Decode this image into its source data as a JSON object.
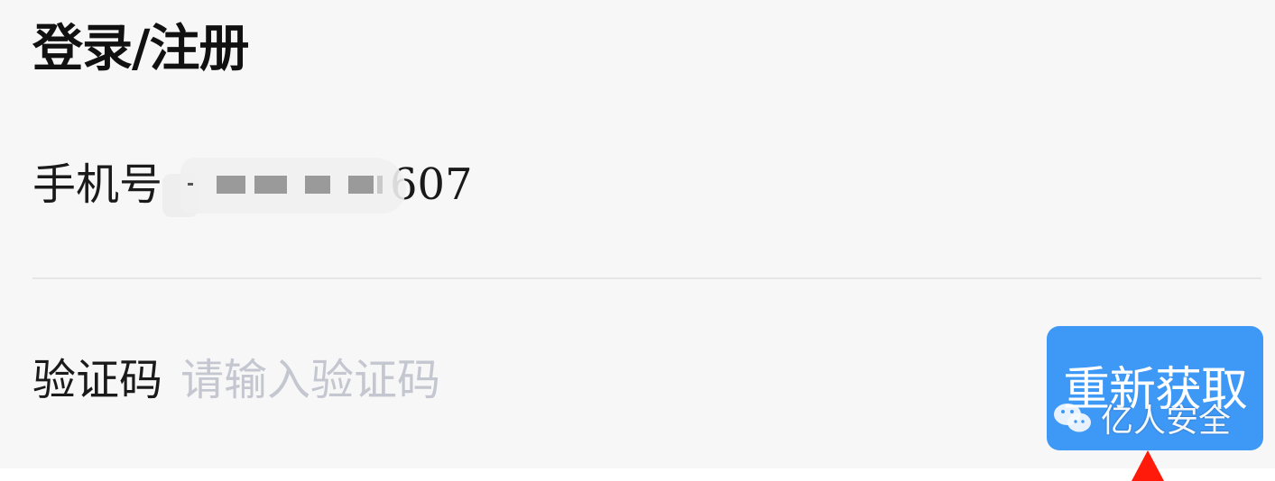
{
  "header": {
    "title": "登录/注册"
  },
  "form": {
    "phone": {
      "label": "手机号",
      "value_suffix": "607"
    },
    "code": {
      "label": "验证码",
      "placeholder": "请输入验证码"
    },
    "resend_button": "重新获取"
  },
  "watermark": {
    "text": "亿人安全",
    "icon": "wechat-icon"
  },
  "colors": {
    "button_bg": "#3e98f6",
    "panel_bg": "#f7f7f7",
    "placeholder": "#c4c7d0",
    "arrow": "#ff1a0a"
  }
}
